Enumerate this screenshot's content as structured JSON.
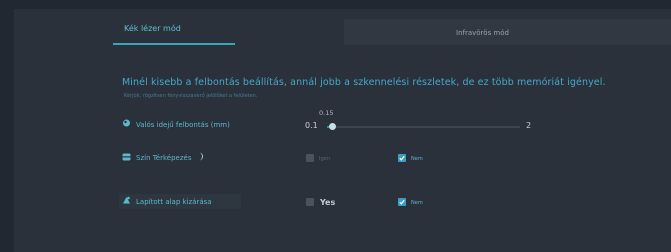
{
  "tabs": [
    {
      "label": "Kék lézer mód",
      "active": true
    },
    {
      "label": "Infravörös mód",
      "active": false
    }
  ],
  "main": {
    "heading": "Minél kisebb a felbontás beállítás, annál jobb a szkennelési részletek, de ez több memóriát igényel.",
    "subtext": "Kérjük, rögzítsen fényvisszaverő jelölőket a felületen."
  },
  "resolution": {
    "label": "Valós idejű felbontás (mm)",
    "min": "0.1",
    "max": "2",
    "value": "0.15",
    "fraction": 0.026
  },
  "color_mapping": {
    "label": "Szín Térképezés",
    "info_icon": "moon-icon",
    "options": [
      {
        "label": "Igen",
        "checked": false
      },
      {
        "label": "Nem",
        "checked": true
      }
    ]
  },
  "exclude_flat_base": {
    "label": "Lapított alap kizárása",
    "options": [
      {
        "label": "Yes",
        "checked": false
      },
      {
        "label": "Nem",
        "checked": true
      }
    ]
  },
  "colors": {
    "background": "#2a313a",
    "accent": "#37a7b7",
    "text_accent": "#5bb8cf"
  }
}
